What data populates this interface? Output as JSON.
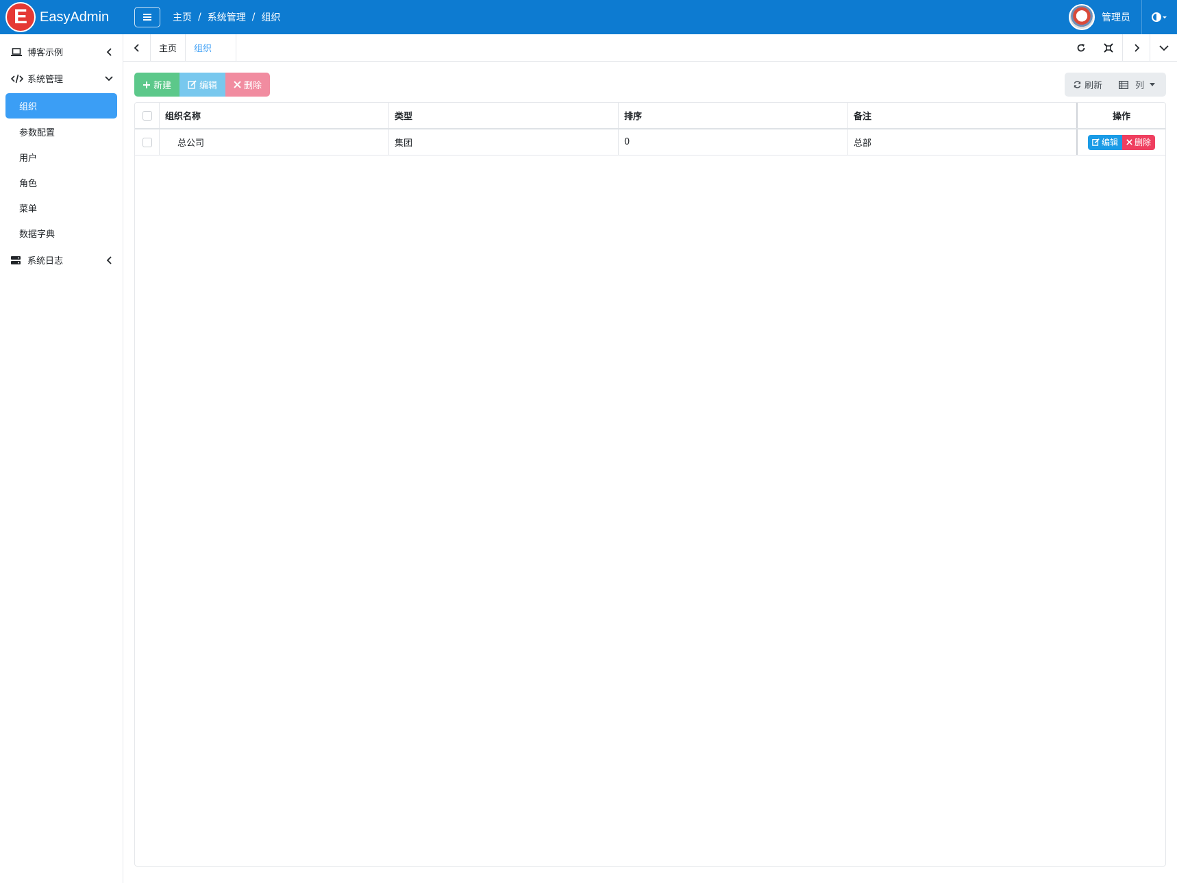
{
  "app": {
    "brand": "EasyAdmin",
    "logo_letter": "E",
    "accent": "#0d7bd1"
  },
  "breadcrumb": [
    "主页",
    "系统管理",
    "组织"
  ],
  "user": {
    "name": "管理员"
  },
  "sidebar": {
    "groups": [
      {
        "label": "博客示例",
        "icon": "laptop-icon",
        "expanded": false
      },
      {
        "label": "系统管理",
        "icon": "code-icon",
        "expanded": true,
        "items": [
          {
            "label": "组织",
            "active": true
          },
          {
            "label": "参数配置"
          },
          {
            "label": "用户"
          },
          {
            "label": "角色"
          },
          {
            "label": "菜单"
          },
          {
            "label": "数据字典"
          }
        ]
      },
      {
        "label": "系统日志",
        "icon": "server-icon",
        "expanded": false
      }
    ]
  },
  "tabs": [
    {
      "label": "主页"
    },
    {
      "label": "组织",
      "active": true
    }
  ],
  "toolbar": {
    "new_label": "新建",
    "edit_label": "编辑",
    "delete_label": "删除",
    "refresh_label": "刷新",
    "columns_label": "列"
  },
  "table": {
    "headers": {
      "name": "组织名称",
      "type": "类型",
      "order": "排序",
      "note": "备注",
      "ops": "操作"
    },
    "rows": [
      {
        "name": "总公司",
        "type": "集团",
        "order": "0",
        "note": "总部",
        "edit": "编辑",
        "delete": "删除"
      }
    ]
  }
}
